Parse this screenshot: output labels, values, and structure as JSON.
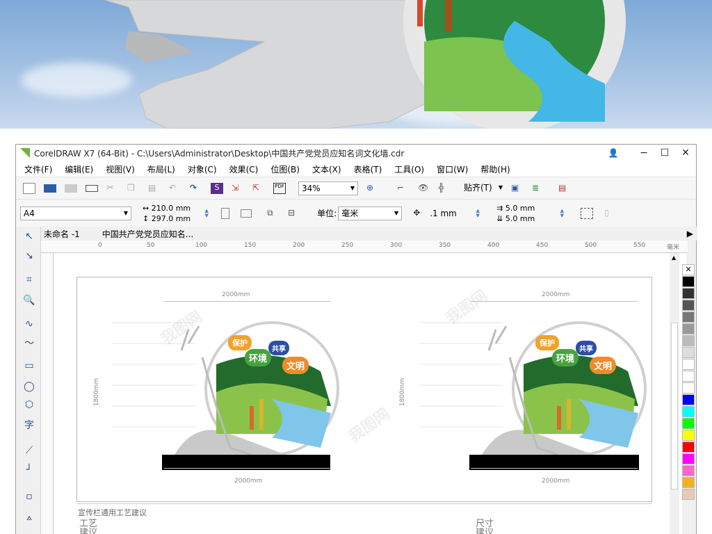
{
  "window": {
    "title": "CorelDRAW X7 (64-Bit) - C:\\Users\\Administrator\\Desktop\\中国共产党党员应知名词文化墙.cdr",
    "minimize": "−",
    "maximize": "☐",
    "close": "✕"
  },
  "menu": [
    "文件(F)",
    "编辑(E)",
    "视图(V)",
    "布局(L)",
    "对象(C)",
    "效果(C)",
    "位图(B)",
    "文本(X)",
    "表格(T)",
    "工具(O)",
    "窗口(W)",
    "帮助(H)"
  ],
  "toolbar": {
    "zoom": "34%",
    "snap": "贴齐(T)"
  },
  "propbar": {
    "page_size": "A4",
    "width": "210.0 mm",
    "height": "297.0 mm",
    "units_label": "单位:",
    "units_value": "毫米",
    "nudge": ".1 mm",
    "dup_x": "5.0 mm",
    "dup_y": "5.0 mm"
  },
  "tabs": [
    "未命名 -1",
    "中国共产党党员应知名..."
  ],
  "ruler_ticks": [
    "0",
    "50",
    "100",
    "150",
    "200",
    "250",
    "300",
    "350",
    "400",
    "450",
    "500",
    "550"
  ],
  "ruler_unit": "毫米",
  "design": {
    "width_top": "2000mm",
    "width_bottom": "2000mm",
    "height": "1800mm",
    "bubble1": "保护",
    "bubble2": "共享",
    "bubble3": "环境",
    "bubble4": "文明",
    "section_title": "宣传栏通用工艺建议",
    "craft_label": "工艺建议",
    "size_label": "尺寸建议"
  },
  "watermark": "我图网",
  "colors": {
    "palette": [
      "#000000",
      "#333333",
      "#555555",
      "#777777",
      "#999999",
      "#bbbbbb",
      "#dddddd",
      "#ffffff",
      "#ffffff",
      "#ffffff",
      "#0000ff",
      "#00ffff",
      "#00ff00",
      "#ffff00",
      "#ff0000",
      "#ff00ff",
      "#ff66cc",
      "#f2b21c",
      "#e8c9b8"
    ]
  }
}
